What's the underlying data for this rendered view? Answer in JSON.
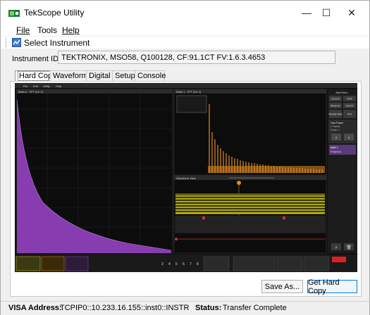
{
  "window": {
    "title": "TekScope Utility",
    "minimize": "—",
    "maximize": "☐",
    "close": "✕"
  },
  "menu": {
    "file": "File",
    "tools": "Tools",
    "help": "Help"
  },
  "toolbar": {
    "select_instrument": "Select Instrument"
  },
  "instrument": {
    "label": "Instrument ID:",
    "value": "TEKTRONIX, MSO58, Q100128, CF:91.1CT FV:1.6.3.4653"
  },
  "tabs": [
    {
      "label": "Hard Copy",
      "active": true
    },
    {
      "label": "Waveform",
      "active": false
    },
    {
      "label": "Digital",
      "active": false
    },
    {
      "label": "Setup",
      "active": false
    },
    {
      "label": "Console",
      "active": false
    }
  ],
  "scope": {
    "menu": [
      "File",
      "Edit",
      "Utility",
      "Help"
    ],
    "left_view_title": "Math 2 - FFT (Ch 1)",
    "right_view_title": "Math 1 - FFT (Ch 1)",
    "waveform_view_title": "Waveform View",
    "side_panel": {
      "title": "Add New...",
      "buttons": [
        "Cursors",
        "Note",
        "Measure",
        "Search",
        "Results Table",
        "Plot"
      ],
      "fast_frame": "Fast Frame",
      "frames": "2 Frames",
      "frame_label": "Frame: 1",
      "math": "Math 1",
      "frequency": "Frequency"
    },
    "colors": {
      "background": "#101010",
      "math2_fft": "#8e3fb8",
      "math1_fft": "#e08a1e",
      "channel1": "#d4cf1a",
      "cursor": "#c0392b",
      "accent_red": "#e02020"
    },
    "bottom_numbers": [
      "2",
      "4",
      "5",
      "6",
      "7",
      "8"
    ]
  },
  "buttons": {
    "save_as": "Save As...",
    "get_hard_copy": "Get Hard Copy"
  },
  "status": {
    "visa_label": "VISA Address:",
    "visa_value": "TCPIP0::10.233.16.155::inst0::INSTR",
    "status_label": "Status:",
    "status_value": "Transfer Complete"
  }
}
